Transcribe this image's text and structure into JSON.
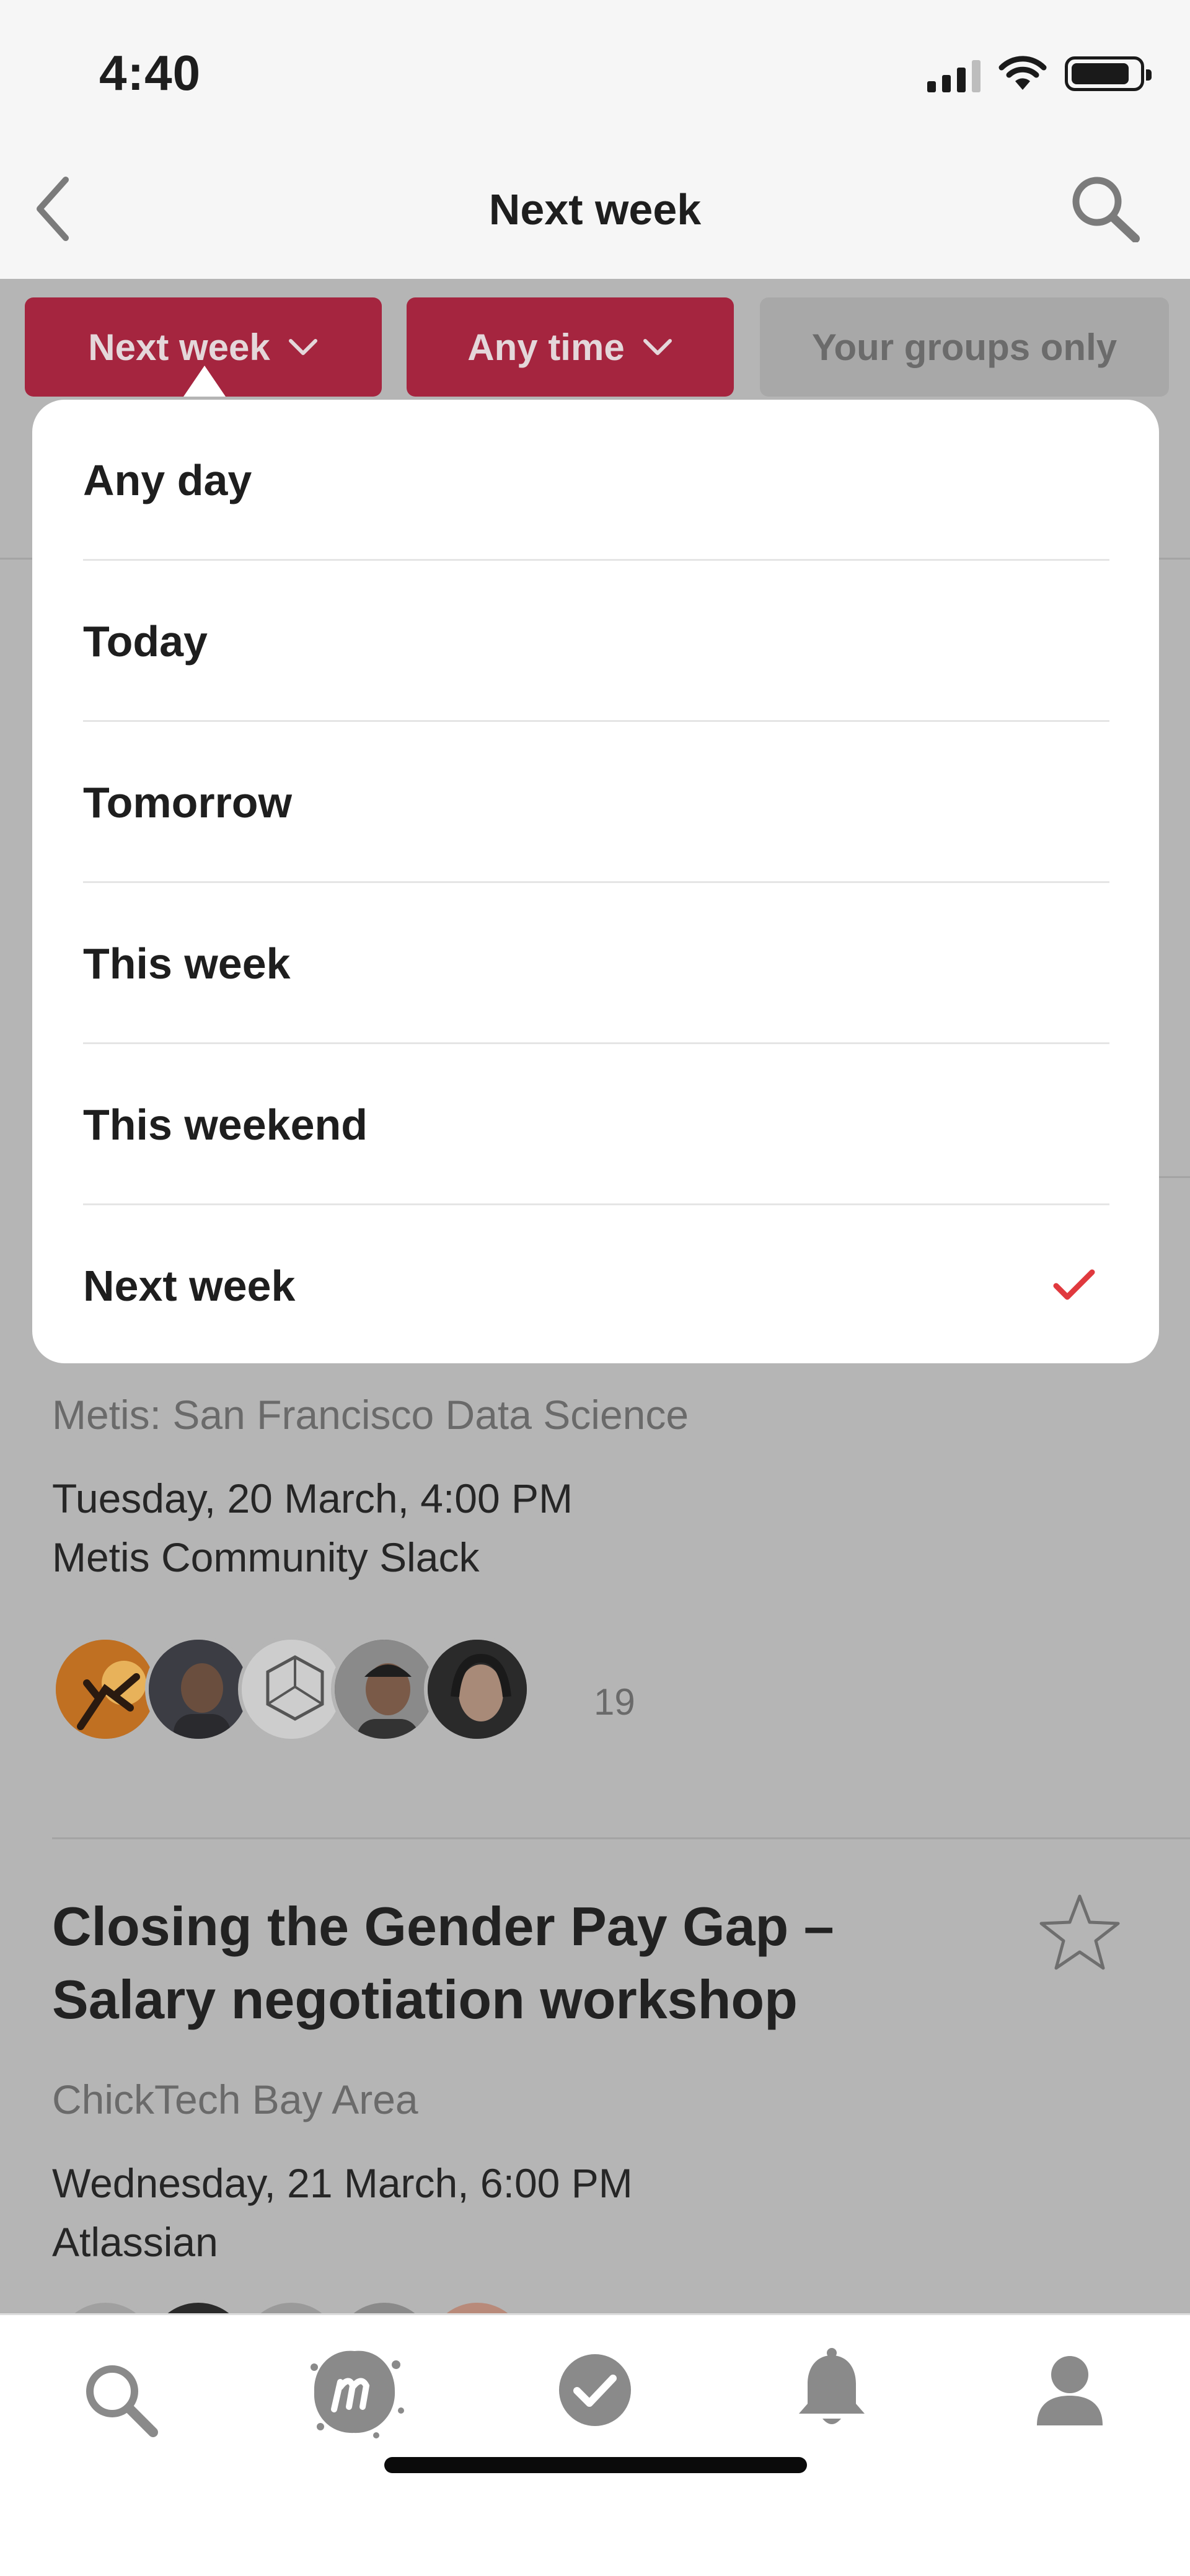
{
  "status_bar": {
    "time": "4:40"
  },
  "nav": {
    "title": "Next week"
  },
  "filters": {
    "date_chip": "Next week",
    "time_chip": "Any time",
    "groups_chip": "Your groups only"
  },
  "dropdown": {
    "items": [
      {
        "label": "Any day"
      },
      {
        "label": "Today"
      },
      {
        "label": "Tomorrow"
      },
      {
        "label": "This week"
      },
      {
        "label": "This weekend"
      },
      {
        "label": "Next week",
        "selected": true
      }
    ],
    "check_color": "#e0393e"
  },
  "events": [
    {
      "group": "Metis: San Francisco Data Science",
      "datetime": "Tuesday, 20 March, 4:00 PM",
      "venue": "Metis Community Slack",
      "attendee_count": "19"
    },
    {
      "title_line1": "Closing the Gender Pay Gap –",
      "title_line2": "Salary negotiation workshop",
      "group": "ChickTech Bay Area",
      "datetime": "Wednesday, 21 March, 6:00 PM",
      "venue": "Atlassian"
    }
  ],
  "tabs": [
    "search-icon",
    "meetup-logo-icon",
    "check-circle-icon",
    "bell-icon",
    "profile-icon"
  ],
  "colors": {
    "accent": "#a5253f",
    "check": "#e0393e",
    "overlay": "#b5b5b5"
  }
}
